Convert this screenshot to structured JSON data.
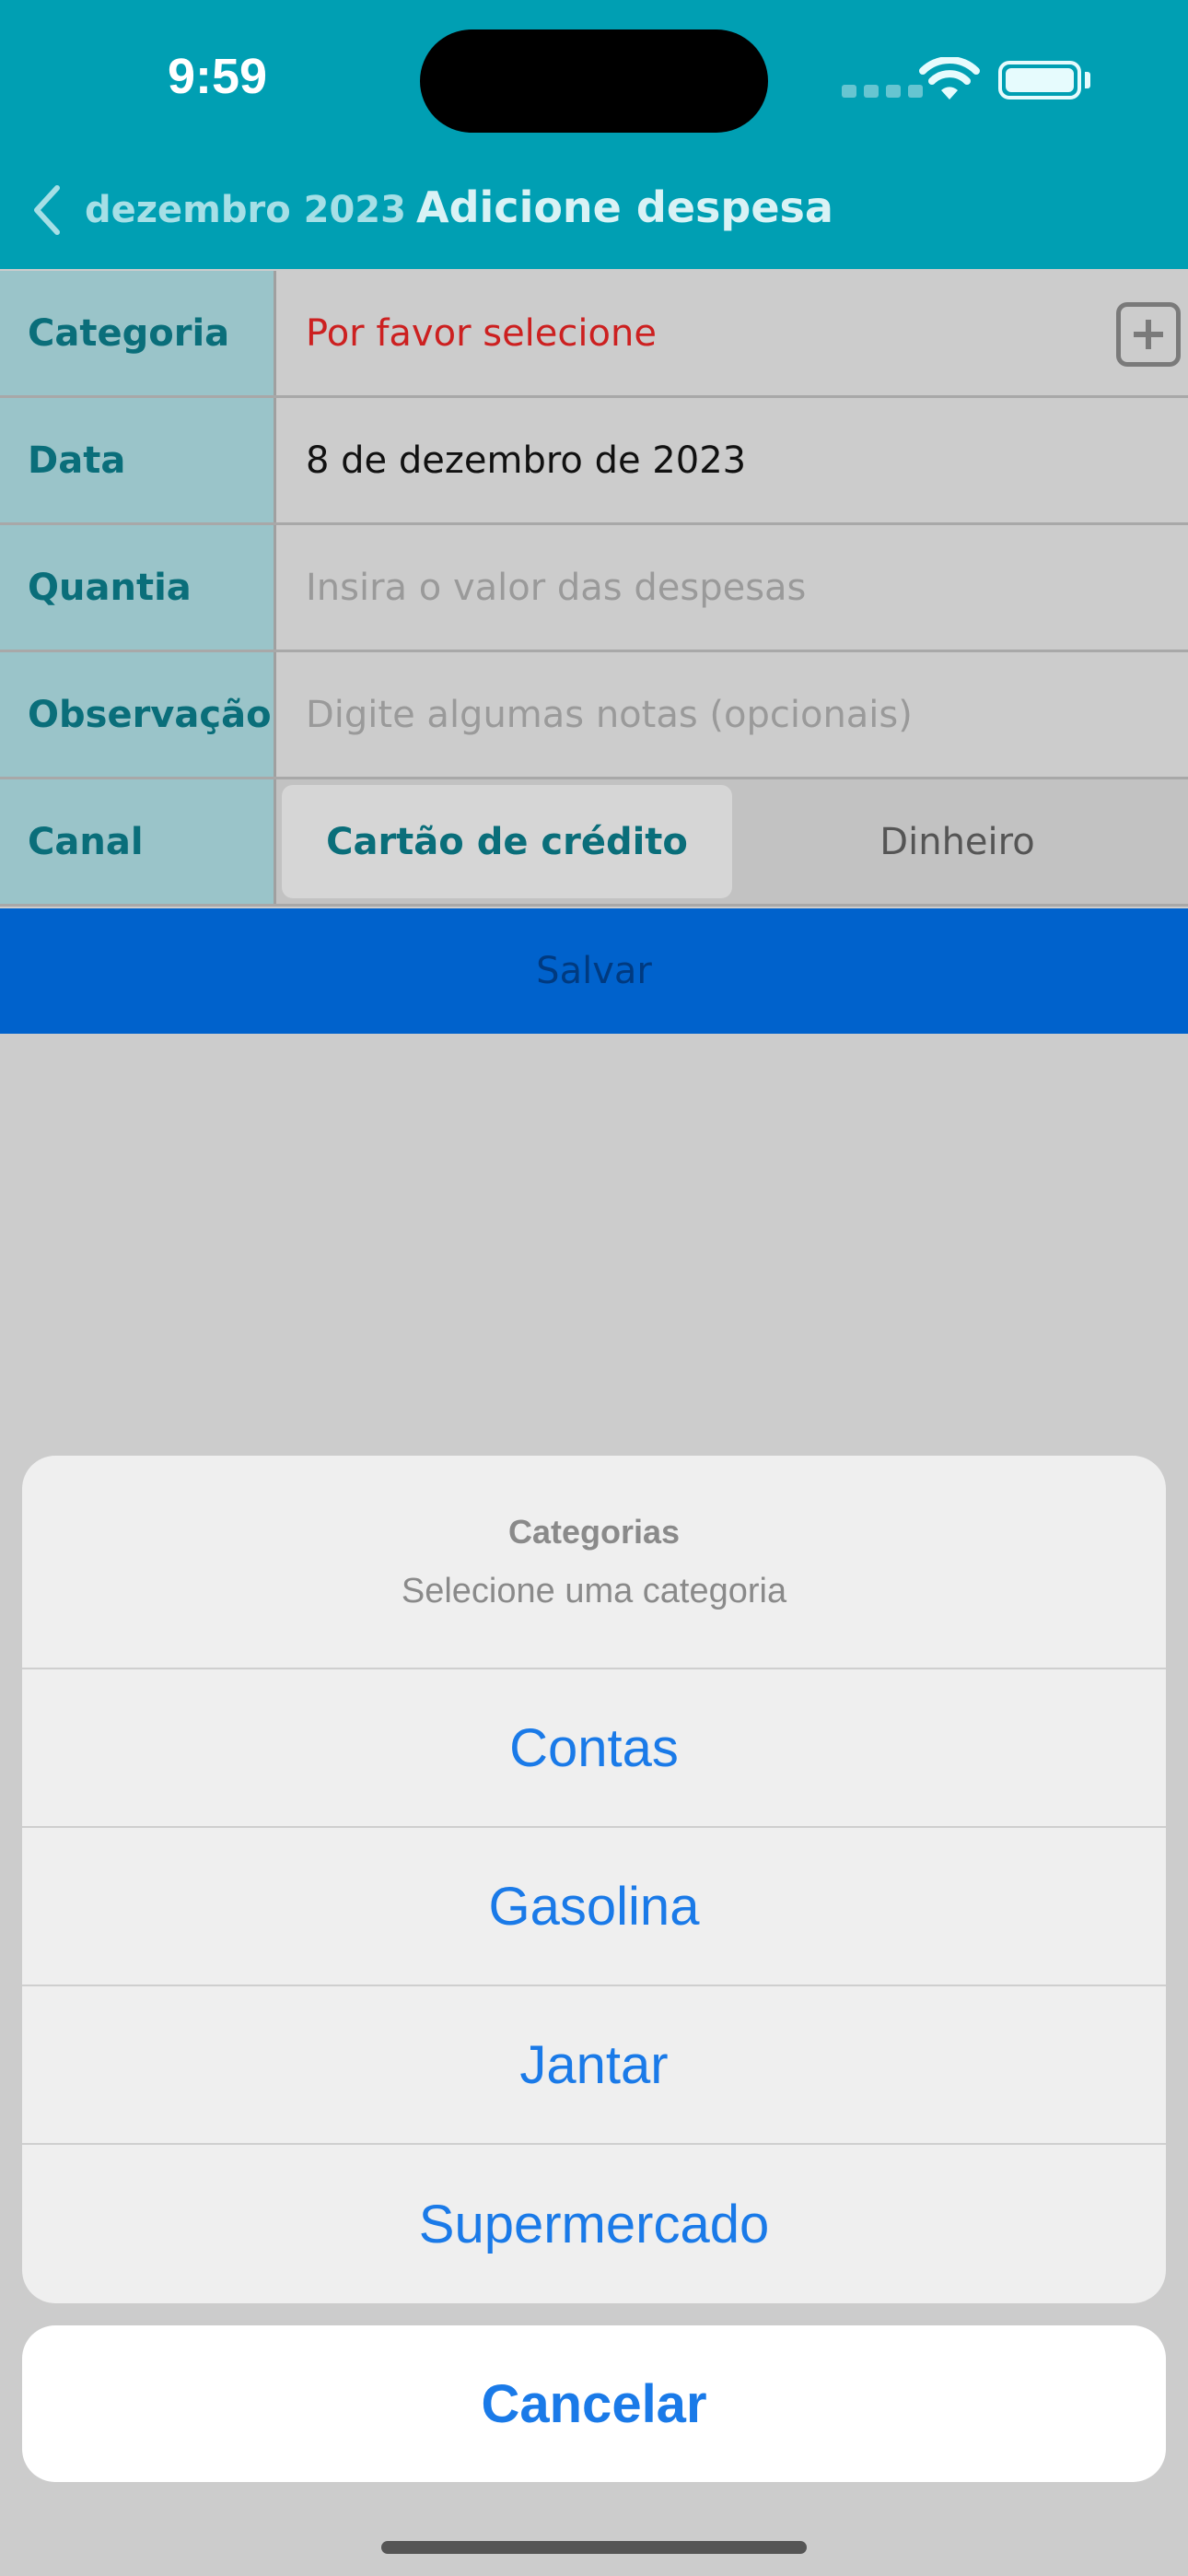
{
  "status_bar": {
    "time": "9:59"
  },
  "nav": {
    "back_label": "dezembro 2023",
    "title": "Adicione despesa"
  },
  "form": {
    "category": {
      "label": "Categoria",
      "value": "Por favor selecione"
    },
    "date": {
      "label": "Data",
      "value": "8 de dezembro de 2023"
    },
    "amount": {
      "label": "Quantia",
      "placeholder": "Insira o valor das despesas"
    },
    "note": {
      "label": "Observação",
      "placeholder": "Digite algumas notas (opcionais)"
    },
    "channel": {
      "label": "Canal",
      "options": [
        "Cartão de crédito",
        "Dinheiro"
      ],
      "selected": "Cartão de crédito"
    }
  },
  "save_label": "Salvar",
  "action_sheet": {
    "title": "Categorias",
    "subtitle": "Selecione uma categoria",
    "items": [
      "Contas",
      "Gasolina",
      "Jantar",
      "Supermercado"
    ],
    "cancel_label": "Cancelar"
  },
  "colors": {
    "header": "#009fb3",
    "accent": "#1a7ae8",
    "save": "#0062cc",
    "error": "#cc2020"
  }
}
